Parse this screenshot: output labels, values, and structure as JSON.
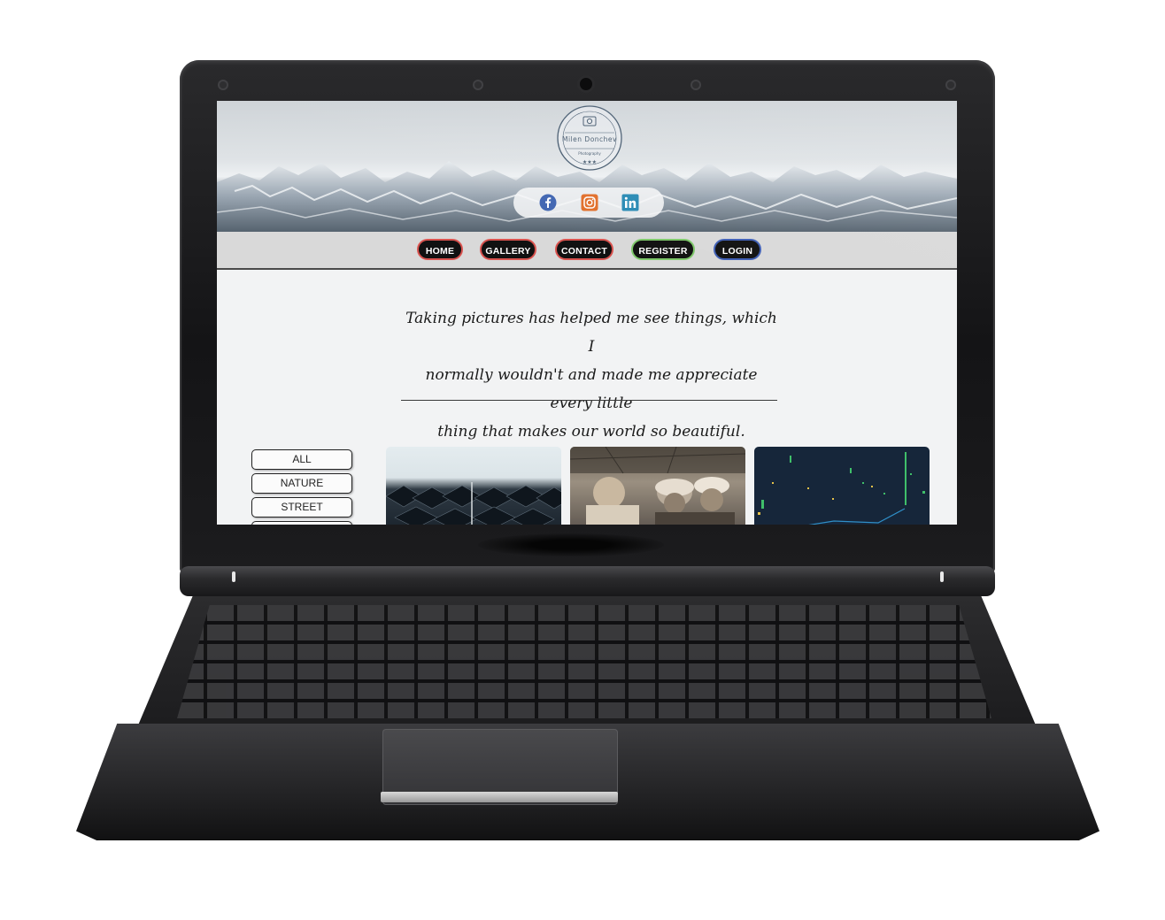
{
  "site": {
    "logo": {
      "name": "Milen Donchev",
      "subtitle": "Photography",
      "stars": "★★★"
    },
    "social": [
      {
        "icon": "facebook-icon",
        "color": "#4267b2"
      },
      {
        "icon": "instagram-icon",
        "color": "#e1702c"
      },
      {
        "icon": "linkedin-icon",
        "color": "#2a8bb5"
      }
    ],
    "nav": [
      {
        "label": "HOME",
        "border": "#d9534f"
      },
      {
        "label": "GALLERY",
        "border": "#d9534f"
      },
      {
        "label": "CONTACT",
        "border": "#d9534f"
      },
      {
        "label": "REGISTER",
        "border": "#7ec86a"
      },
      {
        "label": "LOGIN",
        "border": "#3f5fb5"
      }
    ],
    "quote": {
      "line1": "Taking pictures has helped me see things, which I",
      "line2": "normally wouldn't and made me appreciate every little",
      "line3": "thing that makes our world so beautiful."
    },
    "filters": [
      "ALL",
      "NATURE",
      "STREET"
    ]
  }
}
